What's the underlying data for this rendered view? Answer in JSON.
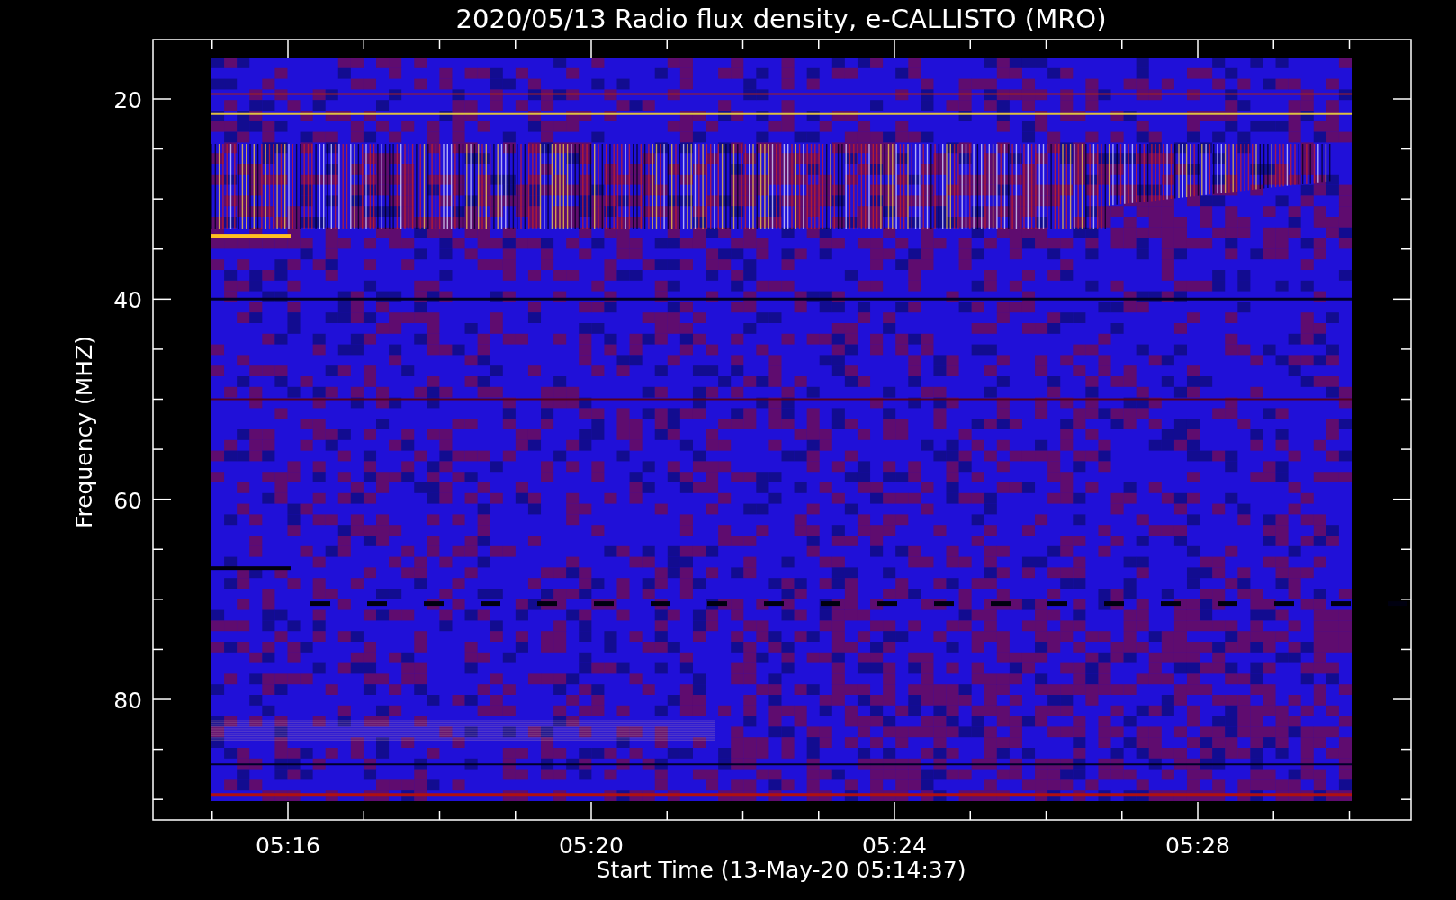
{
  "title": "2020/05/13  Radio flux density, e-CALLISTO (MRO)",
  "y_axis": {
    "label": "Frequency (MHZ)",
    "ticks": [
      "20",
      "40",
      "60",
      "80"
    ]
  },
  "x_axis": {
    "label": "Start Time (13-May-20 05:14:37)",
    "ticks": [
      "05:16",
      "05:20",
      "05:24",
      "05:28"
    ]
  }
}
